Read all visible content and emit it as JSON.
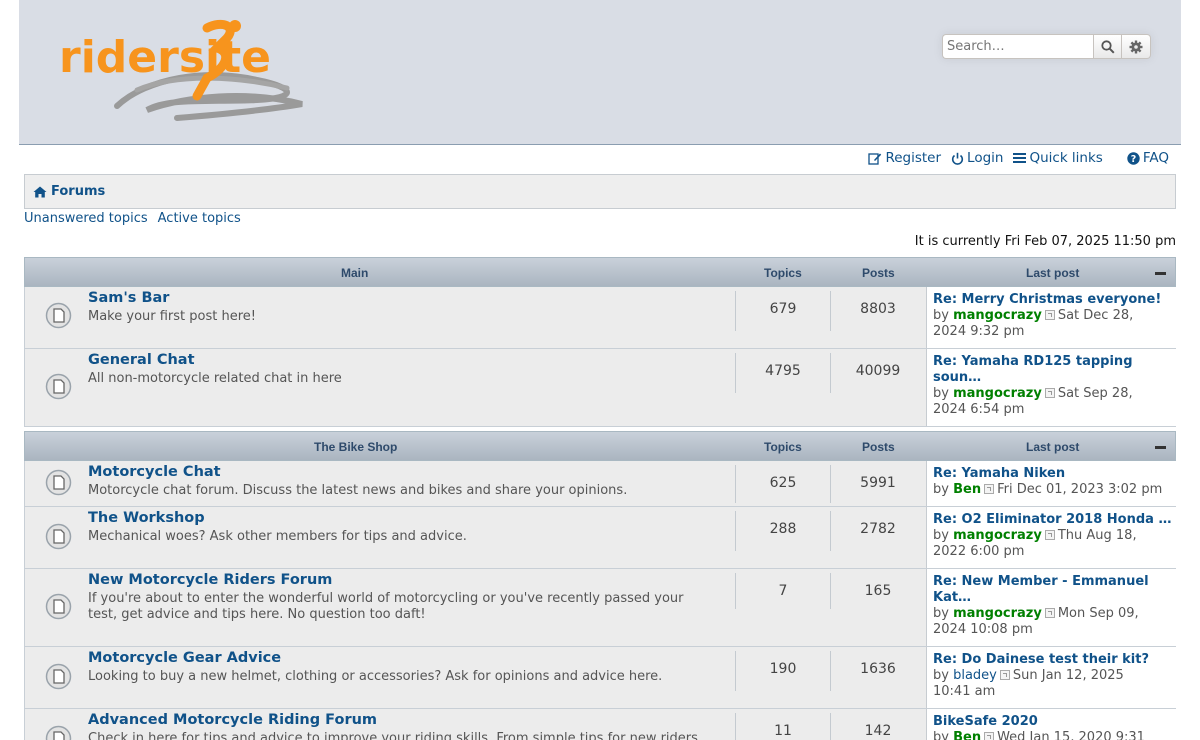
{
  "logo": {
    "text": "ridersite",
    "color": "#f7941d"
  },
  "search": {
    "placeholder": "Search…"
  },
  "nav": {
    "register": "Register",
    "login": "Login",
    "quick_links": "Quick links",
    "faq": "FAQ"
  },
  "breadcrumb": {
    "forums": "Forums"
  },
  "sublinks": {
    "unanswered": "Unanswered topics",
    "active": "Active topics"
  },
  "current_time": "It is currently Fri Feb 07, 2025 11:50 pm",
  "columns": {
    "topics": "Topics",
    "posts": "Posts",
    "last_post": "Last post"
  },
  "categories": [
    {
      "name": "Main",
      "forums": [
        {
          "title": "Sam's Bar",
          "desc": "Make your first post here!",
          "topics": "679",
          "posts": "8803",
          "last_title": "Re: Merry Christmas everyone!",
          "last_by": "by",
          "last_user": "mangocrazy",
          "last_date1": "Sat Dec 28,",
          "last_date2": "2024 9:32 pm"
        },
        {
          "title": "General Chat",
          "desc": "All non-motorcycle related chat in here",
          "topics": "4795",
          "posts": "40099",
          "last_title": "Re: Yamaha RD125 tapping",
          "last_title2": "soun…",
          "last_by": "by",
          "last_user": "mangocrazy",
          "last_date1": "Sat Sep 28,",
          "last_date2": "2024 6:54 pm"
        }
      ]
    },
    {
      "name": "The Bike Shop",
      "forums": [
        {
          "title": "Motorcycle Chat",
          "desc": "Motorcycle chat forum. Discuss the latest news and bikes and share your opinions.",
          "topics": "625",
          "posts": "5991",
          "last_title": "Re: Yamaha Niken",
          "last_by": "by",
          "last_user": "Ben",
          "last_date1": "Fri Dec 01, 2023 3:02 pm"
        },
        {
          "title": "The Workshop",
          "desc": "Mechanical woes? Ask other members for tips and advice.",
          "topics": "288",
          "posts": "2782",
          "last_title": "Re: O2 Eliminator 2018 Honda …",
          "last_by": "by",
          "last_user": "mangocrazy",
          "last_date1": "Thu Aug 18,",
          "last_date2": "2022 6:00 pm"
        },
        {
          "title": "New Motorcycle Riders Forum",
          "desc": "If you're about to enter the wonderful world of motorcycling or you've recently passed your test, get advice and tips here. No question too daft!",
          "topics": "7",
          "posts": "165",
          "last_title": "Re: New Member - Emmanuel",
          "last_title2": "Kat…",
          "last_by": "by",
          "last_user": "mangocrazy",
          "last_date1": "Mon Sep 09,",
          "last_date2": "2024 10:08 pm"
        },
        {
          "title": "Motorcycle Gear Advice",
          "desc": "Looking to buy a new helmet, clothing or accessories? Ask for opinions and advice here.",
          "topics": "190",
          "posts": "1636",
          "last_title": "Re: Do Dainese test their kit?",
          "last_by": "by",
          "last_user": "bladey",
          "last_date1": "Sun Jan 12, 2025",
          "last_date2": "10:41 am"
        },
        {
          "title": "Advanced Motorcycle Riding Forum",
          "desc": "Check in here for tips and advice to improve your riding skills. From simple tips for new riders",
          "topics": "11",
          "posts": "142",
          "last_title": "BikeSafe 2020",
          "last_by": "by",
          "last_user": "Ben",
          "last_date1": "Wed Jan 15, 2020 9:31"
        }
      ]
    }
  ]
}
